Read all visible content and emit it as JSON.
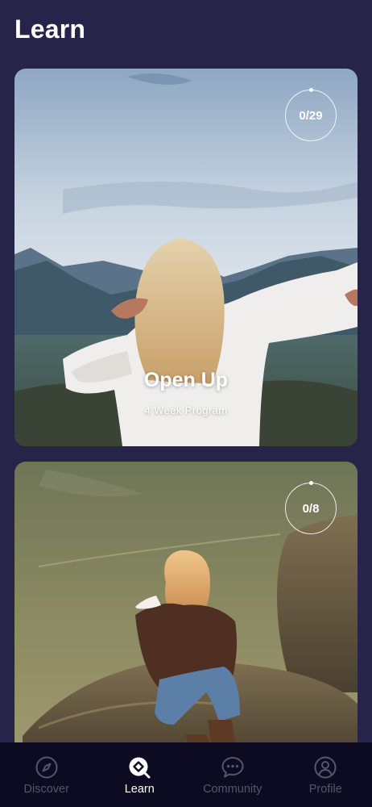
{
  "header": {
    "title": "Learn"
  },
  "programs": [
    {
      "title": "Open Up",
      "subtitle": "4 Week Program",
      "progress": "0/29"
    },
    {
      "title": "",
      "subtitle": "",
      "progress": "0/8"
    }
  ],
  "nav": {
    "items": [
      {
        "label": "Discover",
        "icon": "compass-icon",
        "active": false
      },
      {
        "label": "Learn",
        "icon": "learn-diamond-icon",
        "active": true
      },
      {
        "label": "Community",
        "icon": "chat-bubble-icon",
        "active": false
      },
      {
        "label": "Profile",
        "icon": "person-icon",
        "active": false
      }
    ]
  },
  "colors": {
    "background": "#27244a",
    "nav_background": "#0c0b21",
    "nav_inactive": "#55556e",
    "nav_active": "#ffffff"
  }
}
